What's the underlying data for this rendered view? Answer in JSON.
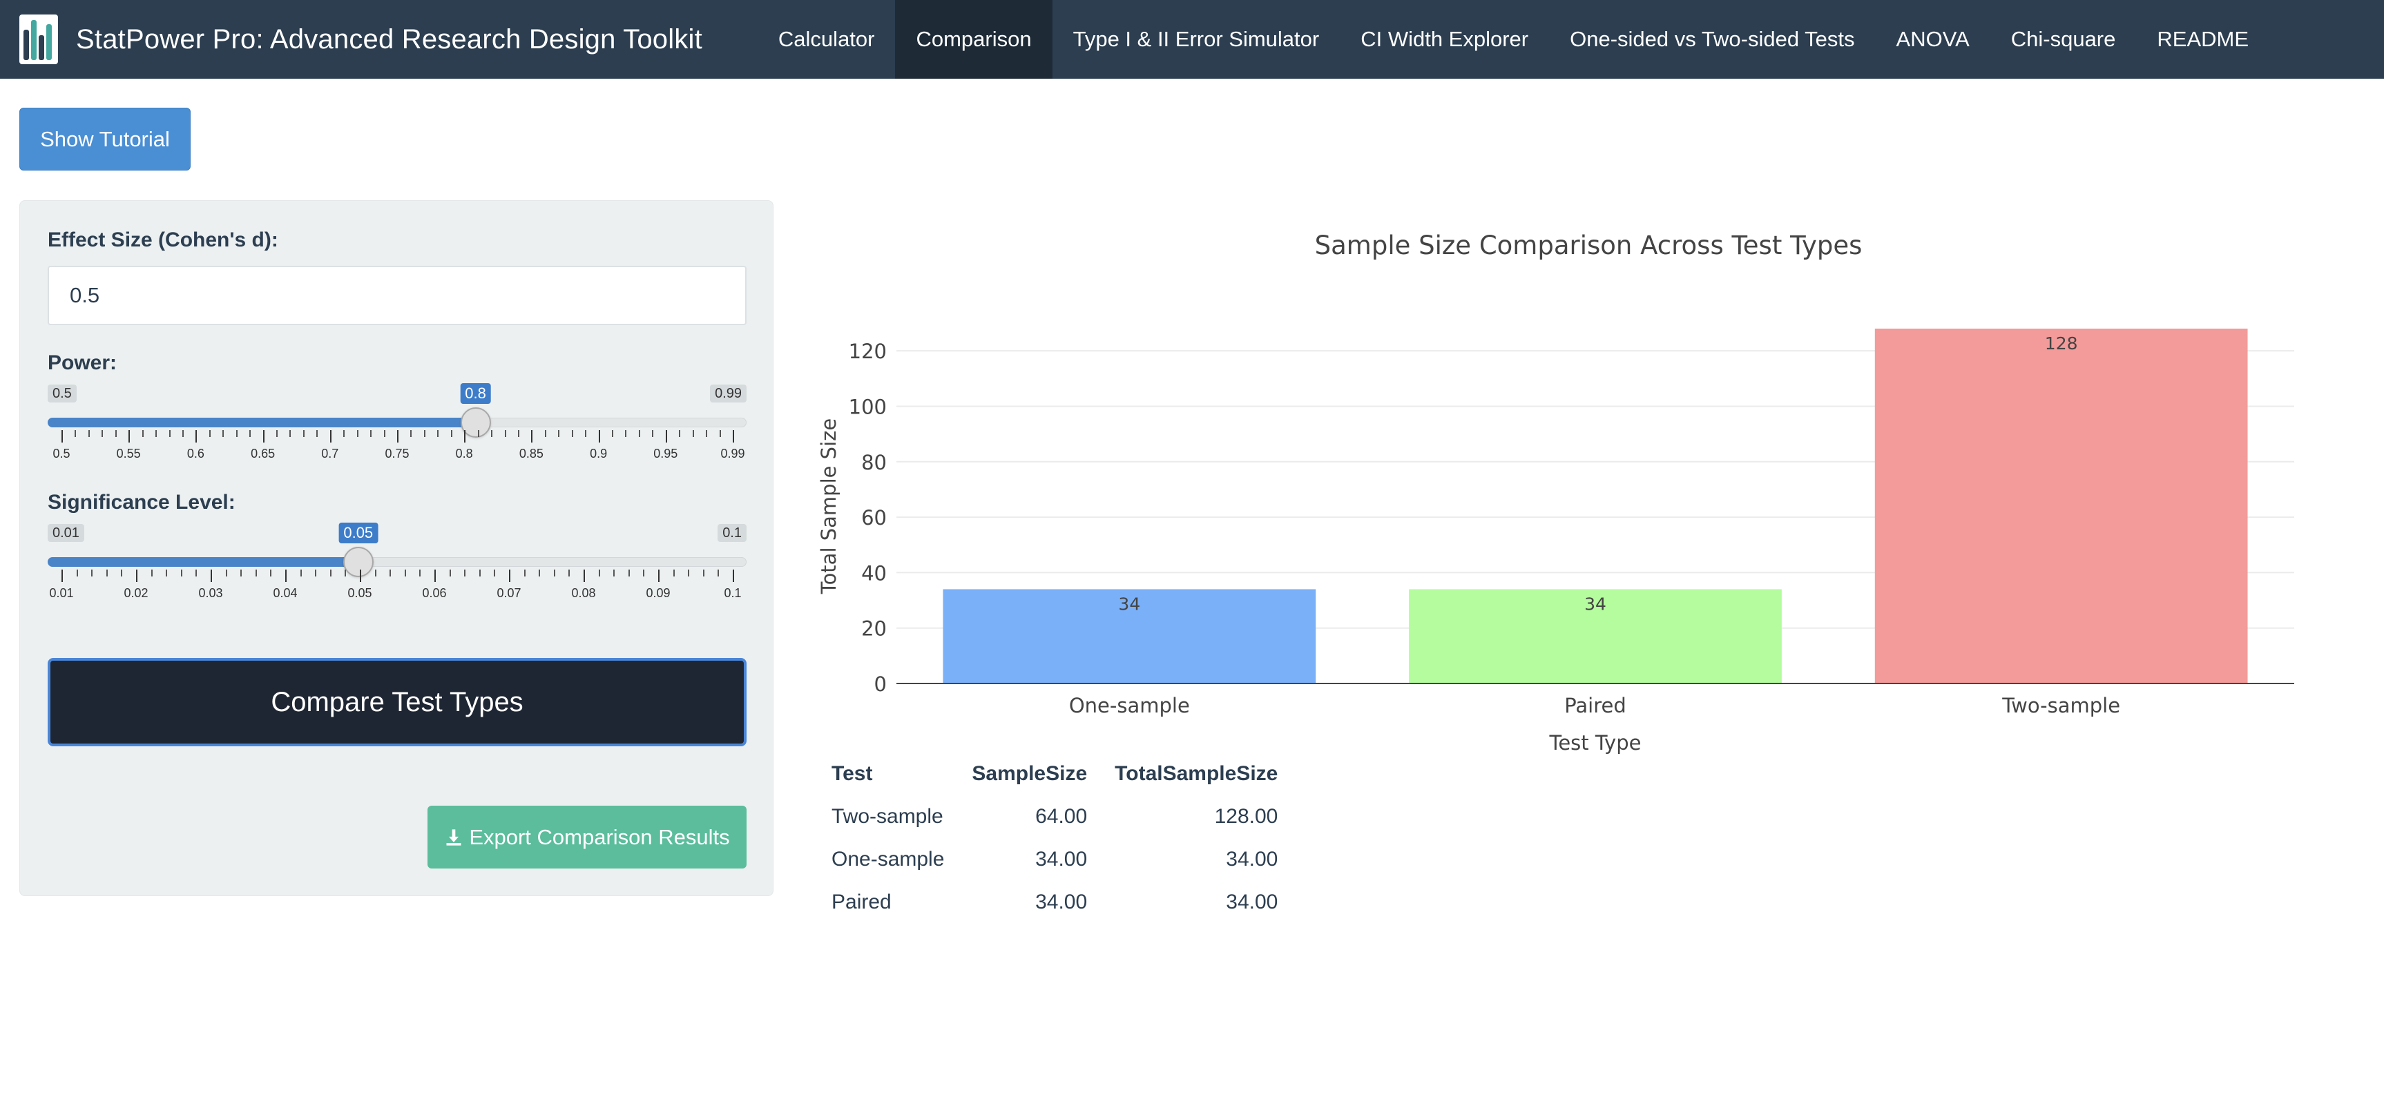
{
  "app": {
    "title": "StatPower Pro: Advanced Research Design Toolkit"
  },
  "nav": {
    "items": [
      {
        "label": "Calculator",
        "active": false
      },
      {
        "label": "Comparison",
        "active": true
      },
      {
        "label": "Type I & II Error Simulator",
        "active": false
      },
      {
        "label": "CI Width Explorer",
        "active": false
      },
      {
        "label": "One-sided vs Two-sided Tests",
        "active": false
      },
      {
        "label": "ANOVA",
        "active": false
      },
      {
        "label": "Chi-square",
        "active": false
      },
      {
        "label": "README",
        "active": false
      }
    ]
  },
  "tutorial": {
    "label": "Show Tutorial"
  },
  "sidebar": {
    "effect_size": {
      "label": "Effect Size (Cohen's d):",
      "value": "0.5"
    },
    "power": {
      "label": "Power:",
      "min": "0.5",
      "max": "0.99",
      "value": "0.8",
      "min_num": 0.5,
      "max_num": 0.99,
      "value_num": 0.8,
      "tick_labels": [
        "0.5",
        "0.55",
        "0.6",
        "0.65",
        "0.7",
        "0.75",
        "0.8",
        "0.85",
        "0.9",
        "0.95",
        "0.99"
      ]
    },
    "alpha": {
      "label": "Significance Level:",
      "min": "0.01",
      "max": "0.1",
      "value": "0.05",
      "min_num": 0.01,
      "max_num": 0.1,
      "value_num": 0.05,
      "tick_labels": [
        "0.01",
        "0.02",
        "0.03",
        "0.04",
        "0.05",
        "0.06",
        "0.07",
        "0.08",
        "0.09",
        "0.1"
      ]
    },
    "compare_label": "Compare Test Types",
    "export_label": "Export Comparison Results"
  },
  "chart_data": {
    "type": "bar",
    "title": "Sample Size Comparison Across Test Types",
    "xlabel": "Test Type",
    "ylabel": "Total Sample Size",
    "categories": [
      "One-sample",
      "Paired",
      "Two-sample"
    ],
    "values": [
      34,
      34,
      128
    ],
    "data_labels": [
      "34",
      "34",
      "128"
    ],
    "colors": [
      "#7ab0f8",
      "#b4fc9e",
      "#f29b9a"
    ],
    "ylim": [
      0,
      128
    ],
    "yticks": [
      0,
      20,
      40,
      60,
      80,
      100,
      120
    ],
    "grid": true
  },
  "table": {
    "headers": [
      "Test",
      "SampleSize",
      "TotalSampleSize"
    ],
    "rows": [
      [
        "Two-sample",
        "64.00",
        "128.00"
      ],
      [
        "One-sample",
        "34.00",
        "34.00"
      ],
      [
        "Paired",
        "34.00",
        "34.00"
      ]
    ]
  }
}
